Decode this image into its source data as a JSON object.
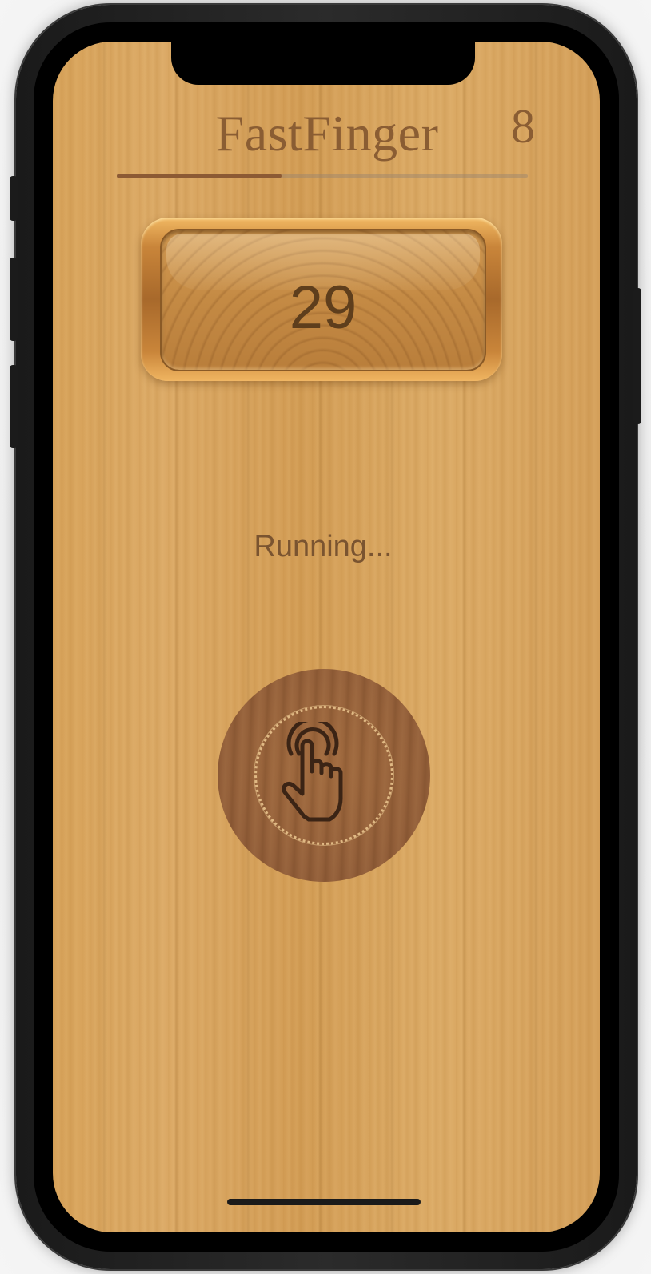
{
  "app": {
    "title": "FastFinger",
    "score": "8"
  },
  "progress": {
    "fraction": 0.4
  },
  "timer": {
    "value": "29"
  },
  "status": {
    "text": "Running..."
  },
  "tap_button": {
    "icon": "tap-hand-icon"
  },
  "colors": {
    "text_brown": "#8a5d33",
    "progress_fill": "#8c5a34",
    "timer_text": "#5e3e1c"
  }
}
